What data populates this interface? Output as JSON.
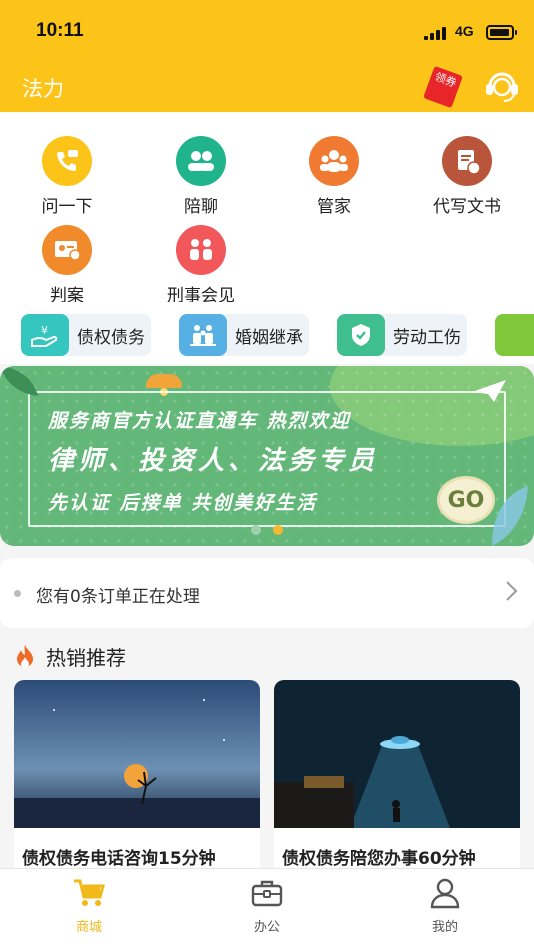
{
  "status_bar": {
    "time": "10:11",
    "network": "4G"
  },
  "header": {
    "title": "法力",
    "coupon_label": "领券"
  },
  "services": [
    {
      "label": "问一下",
      "icon": "phone-chat-icon",
      "color": "#fcc419"
    },
    {
      "label": "陪聊",
      "icon": "people-icon",
      "color": "#1fb48c"
    },
    {
      "label": "管家",
      "icon": "group-icon",
      "color": "#f07a32"
    },
    {
      "label": "代写文书",
      "icon": "document-icon",
      "color": "#b9553b"
    },
    {
      "label": "判案",
      "icon": "judge-card-icon",
      "color": "#f08a2a"
    },
    {
      "label": "刑事会见",
      "icon": "meeting-icon",
      "color": "#f2585a"
    }
  ],
  "categories": [
    {
      "label": "债权债务",
      "icon": "money-hand-icon",
      "color": "#34c6bf"
    },
    {
      "label": "婚姻继承",
      "icon": "family-icon",
      "color": "#56b0e4"
    },
    {
      "label": "劳动工伤",
      "icon": "shield-check-icon",
      "color": "#3fbf8f"
    }
  ],
  "banner": {
    "line1": "服务商官方认证直通车  热烈欢迎",
    "line2": "律师、投资人、法务专员",
    "line3": "先认证 后接单 共创美好生活",
    "go_label": "GO",
    "page_count": 2,
    "active_page": 2
  },
  "orders": {
    "text": "您有0条订单正在处理"
  },
  "hot": {
    "title": "热销推荐",
    "items": [
      {
        "title": "债权债务电话咨询15分钟"
      },
      {
        "title": "债权债务陪您办事60分钟"
      }
    ]
  },
  "tabbar": [
    {
      "label": "商城",
      "icon": "cart-icon",
      "active": true
    },
    {
      "label": "办公",
      "icon": "briefcase-icon",
      "active": false
    },
    {
      "label": "我的",
      "icon": "user-icon",
      "active": false
    }
  ],
  "colors": {
    "brand": "#fcc419",
    "active_tab": "#f2b91a"
  }
}
